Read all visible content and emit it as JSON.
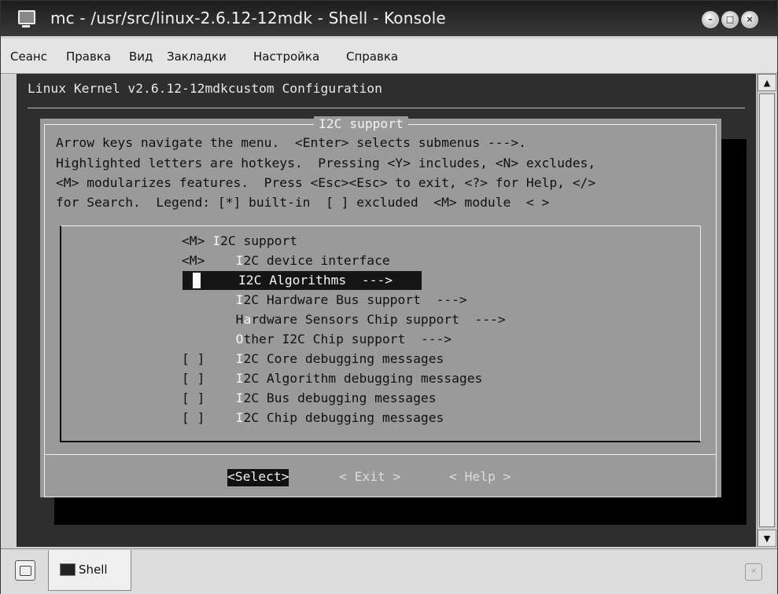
{
  "window": {
    "title": "mc - /usr/src/linux-2.6.12-12mdk - Shell - Konsole"
  },
  "menubar": {
    "items": [
      "Сеанс",
      "Правка",
      "Вид",
      "Закладки",
      "Настройка",
      "Справка"
    ]
  },
  "terminal": {
    "header": "Linux Kernel v2.6.12-12mdkcustom Configuration",
    "dialog_title": "I2C support",
    "help_lines": [
      "Arrow keys navigate the menu.  <Enter> selects submenus --->.",
      "Highlighted letters are hotkeys.  Pressing <Y> includes, <N> excludes,",
      "<M> modularizes features.  Press <Esc><Esc> to exit, <?> for Help, </>",
      "for Search.  Legend: [*] built-in  [ ] excluded  <M> module  < >"
    ],
    "items": [
      {
        "prefix": "<M>",
        "hot": "I",
        "rest": "2C support"
      },
      {
        "prefix": "<M>",
        "hot": "I",
        "rest": "2C device interface"
      },
      {
        "prefix": "",
        "hot": "",
        "rest": "I2C Algorithms  --->"
      },
      {
        "prefix": "",
        "hot": "I",
        "rest": "2C Hardware Bus support  --->"
      },
      {
        "prefix": "H",
        "hot": "a",
        "rest": "rdware Sensors Chip support  --->"
      },
      {
        "prefix": "",
        "hot": "O",
        "rest": "ther I2C Chip support  --->"
      },
      {
        "prefix": "[ ]",
        "hot": "I",
        "rest": "2C Core debugging messages"
      },
      {
        "prefix": "[ ]",
        "hot": "I",
        "rest": "2C Algorithm debugging messages"
      },
      {
        "prefix": "[ ]",
        "hot": "I",
        "rest": "2C Bus debugging messages"
      },
      {
        "prefix": "[ ]",
        "hot": "I",
        "rest": "2C Chip debugging messages"
      }
    ],
    "buttons": {
      "select": "<Select>",
      "exit": "< Exit >",
      "help": "< Help >"
    }
  },
  "tabs": [
    {
      "label": "Shell"
    }
  ]
}
